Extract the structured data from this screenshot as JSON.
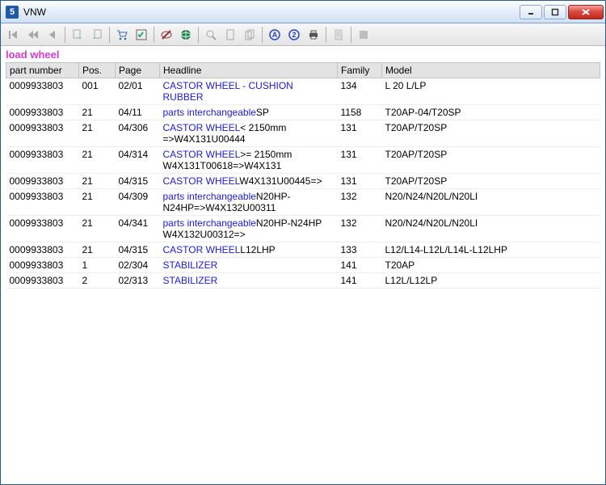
{
  "window": {
    "title": "VNW",
    "app_icon_letter": "5"
  },
  "search_label": "load wheel",
  "columns": {
    "part": "part number",
    "pos": "Pos.",
    "page": "Page",
    "headline": "Headline",
    "family": "Family",
    "model": "Model"
  },
  "rows": [
    {
      "part": "0009933803",
      "pos": "001",
      "page": "02/01",
      "headline_link": "CASTOR WHEEL - CUSHION RUBBER",
      "headline_plain": "",
      "family": "134",
      "model": "L 20 L/LP"
    },
    {
      "part": "0009933803",
      "pos": "21",
      "page": "04/11",
      "headline_link": "parts interchangeable",
      "headline_plain": "SP",
      "family": "1158",
      "model": "T20AP-04/T20SP"
    },
    {
      "part": "0009933803",
      "pos": "21",
      "page": "04/306",
      "headline_link": "CASTOR WHEEL",
      "headline_plain": "< 2150mm =>W4X131U00444",
      "family": "131",
      "model": "T20AP/T20SP"
    },
    {
      "part": "0009933803",
      "pos": "21",
      "page": "04/314",
      "headline_link": "CASTOR WHEEL",
      "headline_plain": ">= 2150mm W4X131T00618=>W4X131",
      "family": "131",
      "model": "T20AP/T20SP"
    },
    {
      "part": "0009933803",
      "pos": "21",
      "page": "04/315",
      "headline_link": "CASTOR WHEEL",
      "headline_plain": "W4X131U00445=>",
      "family": "131",
      "model": "T20AP/T20SP"
    },
    {
      "part": "0009933803",
      "pos": "21",
      "page": "04/309",
      "headline_link": "parts interchangeable",
      "headline_plain": "N20HP-N24HP=>W4X132U00311",
      "family": "132",
      "model": "N20/N24/N20L/N20LI"
    },
    {
      "part": "0009933803",
      "pos": "21",
      "page": "04/341",
      "headline_link": "parts interchangeable",
      "headline_plain": "N20HP-N24HP W4X132U00312=>",
      "family": "132",
      "model": "N20/N24/N20L/N20LI"
    },
    {
      "part": "0009933803",
      "pos": "21",
      "page": "04/315",
      "headline_link": "CASTOR WHEEL",
      "headline_plain": "L12LHP",
      "family": "133",
      "model": "L12/L14-L12L/L14L-L12LHP"
    },
    {
      "part": "0009933803",
      "pos": "1",
      "page": "02/304",
      "headline_link": "STABILIZER",
      "headline_plain": "",
      "family": "141",
      "model": "T20AP"
    },
    {
      "part": "0009933803",
      "pos": "2",
      "page": "02/313",
      "headline_link": "STABILIZER",
      "headline_plain": "",
      "family": "141",
      "model": "L12L/L12LP"
    }
  ],
  "toolbar_icons": [
    "first-icon",
    "prev-fast-icon",
    "prev-icon",
    "sep",
    "export-left-icon",
    "export-right-icon",
    "sep",
    "cart-icon",
    "checklist-icon",
    "sep",
    "eye-off-icon",
    "globe-icon",
    "sep",
    "zoom-icon",
    "page-icon",
    "pages-icon",
    "sep",
    "a-circle-icon",
    "two-circle-icon",
    "print-icon",
    "sep",
    "doc-icon",
    "sep",
    "stop-icon"
  ]
}
